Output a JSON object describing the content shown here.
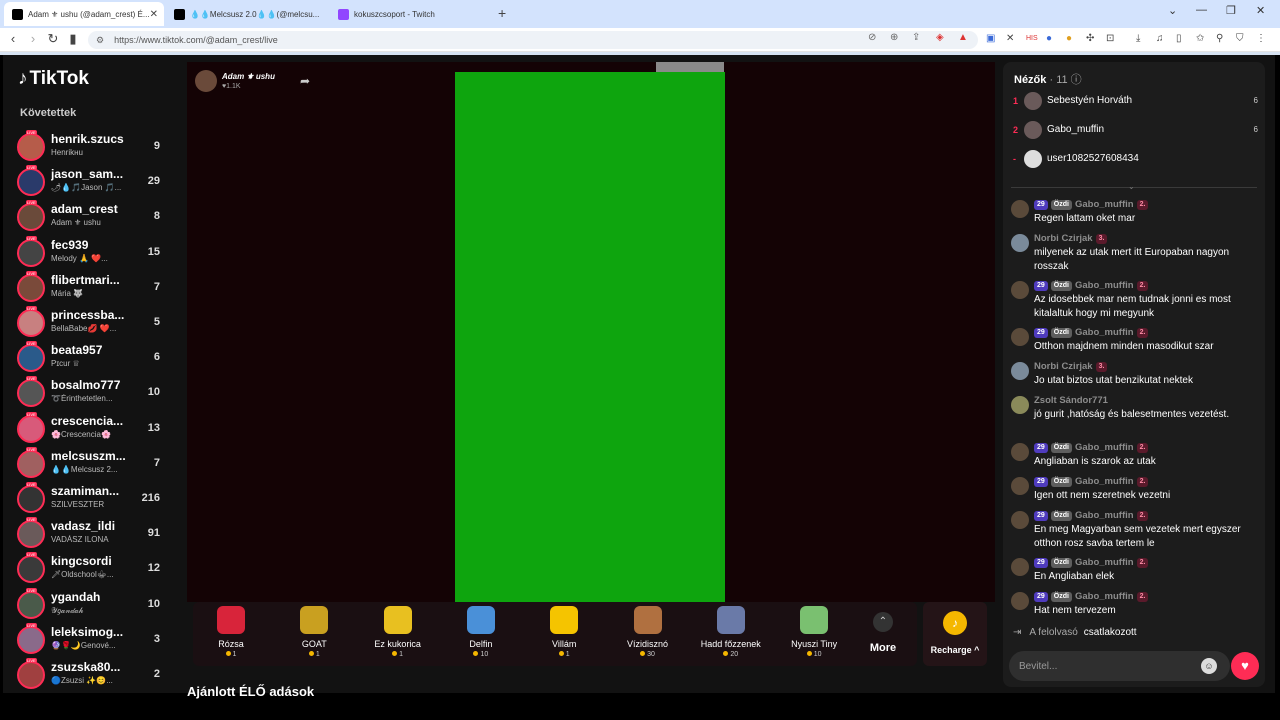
{
  "browser": {
    "tabs": [
      {
        "label": "Adam ⚜ ushu (@adam_crest) É...",
        "active": true
      },
      {
        "label": "💧💧Melcsusz 2.0💧💧(@melcsu...",
        "active": false
      },
      {
        "label": "kokuszcsoport - Twitch",
        "active": false
      }
    ],
    "new_tab": "+",
    "url": "https://www.tiktok.com/@adam_crest/live"
  },
  "sidebar": {
    "logo": "TikTok",
    "section_title": "Követettek",
    "items": [
      {
        "username": "henrik.szucs",
        "display": "Henrikнu",
        "count": "9",
        "avatar_color": "#b65c4a"
      },
      {
        "username": "jason_sam...",
        "display": "🌶💧🎵Jason 🎵...",
        "count": "29",
        "avatar_color": "#2a3a6a"
      },
      {
        "username": "adam_crest",
        "display": "Adam ⚜ ushu",
        "count": "8",
        "avatar_color": "#6a4a3a"
      },
      {
        "username": "fec939",
        "display": "Melody 🙏 ❤️...",
        "count": "15",
        "avatar_color": "#444"
      },
      {
        "username": "flibertmari...",
        "display": "Mária 🐺",
        "count": "7",
        "avatar_color": "#7a4a3a"
      },
      {
        "username": "princessba...",
        "display": "BellaBabe💋 ❤️...",
        "count": "5",
        "avatar_color": "#c88080"
      },
      {
        "username": "beata957",
        "display": "Pɪcur ♕",
        "count": "6",
        "avatar_color": "#2a5a8a"
      },
      {
        "username": "bosalmo777",
        "display": "➰Érinthetetlen...",
        "count": "10",
        "avatar_color": "#555"
      },
      {
        "username": "crescencia...",
        "display": "🌸Crescencia🌸",
        "count": "13",
        "avatar_color": "#d85a7a"
      },
      {
        "username": "melcsuszm...",
        "display": "💧💧Melcsusz 2...",
        "count": "7",
        "avatar_color": "#a06060"
      },
      {
        "username": "szamiman...",
        "display": "SZILVESZTER",
        "count": "216",
        "avatar_color": "#333"
      },
      {
        "username": "vadasz_ildi",
        "display": "VADÁSZ ILONA",
        "count": "91",
        "avatar_color": "#6a5a5a"
      },
      {
        "username": "kingcsordi",
        "display": "🗡Oldschool⚜...",
        "count": "12",
        "avatar_color": "#3a3a3a"
      },
      {
        "username": "ygandah",
        "display": "𝒴𝑔𝒶𝓃𝒹𝒶𝒽",
        "count": "10",
        "avatar_color": "#4a5a4a"
      },
      {
        "username": "leleksimog...",
        "display": "🔮🌹🌙Genové...",
        "count": "3",
        "avatar_color": "#8a6a8a"
      },
      {
        "username": "zsuzska80...",
        "display": "🔵Zsuzsi ✨😊...",
        "count": "2",
        "avatar_color": "#a04040"
      }
    ]
  },
  "stage": {
    "host_name": "Adam ⚜ ushu",
    "host_likes": "♥1.1K",
    "share_icon": "share-icon",
    "video_color": "#0ea50e"
  },
  "gifts": [
    {
      "name": "Rózsa",
      "price": "1",
      "color": "#d8243a"
    },
    {
      "name": "GOAT",
      "price": "1",
      "color": "#c9a020"
    },
    {
      "name": "Ez kukorica",
      "price": "1",
      "color": "#e8c020"
    },
    {
      "name": "Delfin",
      "price": "10",
      "color": "#4a90d8"
    },
    {
      "name": "Villám",
      "price": "1",
      "color": "#f5c400"
    },
    {
      "name": "Vízidisznó",
      "price": "30",
      "color": "#b07040"
    },
    {
      "name": "Hadd főzzenek",
      "price": "20",
      "color": "#6a7aa8"
    },
    {
      "name": "Nyuszi Tiny",
      "price": "10",
      "color": "#7ac070"
    }
  ],
  "gift_more": "More",
  "recharge": "Recharge ^",
  "suggested_title": "Ajánlott ÉLŐ adások",
  "chat": {
    "viewers_label": "Nézők",
    "viewers_count": "· 11",
    "top_viewers": [
      {
        "rank": "1",
        "name": "Sebestyén Horváth",
        "score": "6"
      },
      {
        "rank": "2",
        "name": "Gabo_muffin",
        "score": "6"
      },
      {
        "rank": "-",
        "name": "user1082527608434",
        "score": ""
      }
    ],
    "messages": [
      {
        "name": "Gabo_muffin",
        "level": "29",
        "fan": "Özdi",
        "rank": "2.",
        "text": "Regen lattam oket mar"
      },
      {
        "name": "Norbi Czirjak",
        "level": "",
        "fan": "",
        "rank": "3.",
        "text": "milyenek az utak mert itt Europaban nagyon rosszak"
      },
      {
        "name": "Gabo_muffin",
        "level": "29",
        "fan": "Özdi",
        "rank": "2.",
        "text": "Az idosebbek mar nem tudnak jonni es most kitalaltuk hogy mi megyunk"
      },
      {
        "name": "Gabo_muffin",
        "level": "29",
        "fan": "Özdi",
        "rank": "2.",
        "text": "Otthon majdnem minden masodikut szar"
      },
      {
        "name": "Norbi Czirjak",
        "level": "",
        "fan": "",
        "rank": "3.",
        "text": "Jo utat biztos utat benzikutat nektek"
      },
      {
        "name": "Zsolt Sándor771",
        "level": "",
        "fan": "",
        "rank": "",
        "text": "jó gurit ,hatóság és balesetmentes vezetést."
      },
      {
        "name": "Gabo_muffin",
        "level": "29",
        "fan": "Özdi",
        "rank": "2.",
        "text": "Angliaban is szarok az utak"
      },
      {
        "name": "Gabo_muffin",
        "level": "29",
        "fan": "Özdi",
        "rank": "2.",
        "text": "Igen ott nem szeretnek vezetni"
      },
      {
        "name": "Gabo_muffin",
        "level": "29",
        "fan": "Özdi",
        "rank": "2.",
        "text": "En meg Magyarban sem vezetek mert egyszer otthon rosz savba tertem le"
      },
      {
        "name": "Gabo_muffin",
        "level": "29",
        "fan": "Özdi",
        "rank": "2.",
        "text": "En Angliaban elek"
      },
      {
        "name": "Gabo_muffin",
        "level": "29",
        "fan": "Özdi",
        "rank": "2.",
        "text": "Hat nem tervezem"
      }
    ],
    "joined_user": "A felolvasó",
    "joined_text": "csatlakozott",
    "input_placeholder": "Bevitel..."
  }
}
